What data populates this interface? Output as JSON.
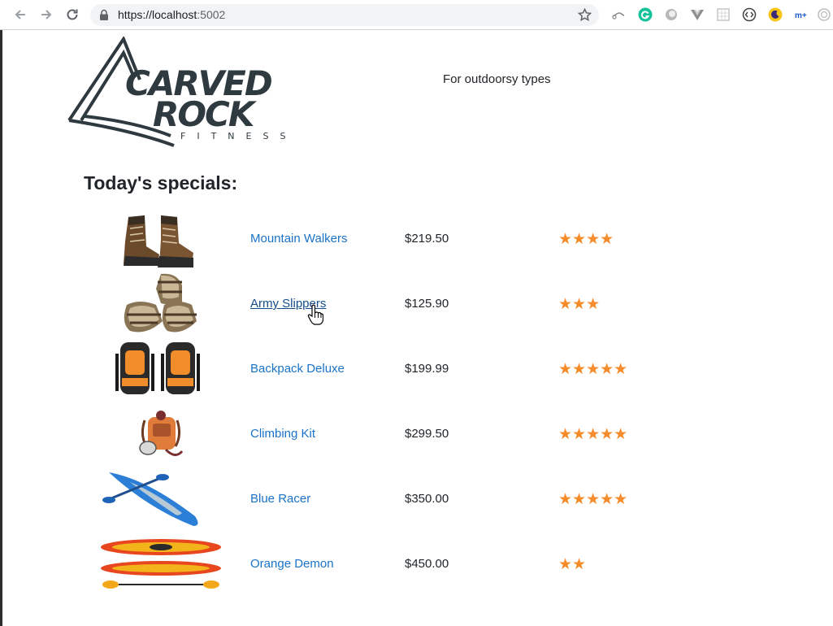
{
  "browser": {
    "url": "https://localhost:5002",
    "url_host": "https://localhost",
    "url_port": ":5002"
  },
  "header": {
    "logo_text": "CARVED ROCK FITNESS",
    "tagline": "For outdoorsy types"
  },
  "main": {
    "title": "Today's specials:",
    "products": [
      {
        "name": "Mountain Walkers",
        "price": "$219.50",
        "rating": 4,
        "stars": "★★★★"
      },
      {
        "name": "Army Slippers",
        "price": "$125.90",
        "rating": 3,
        "stars": "★★★"
      },
      {
        "name": "Backpack Deluxe",
        "price": "$199.99",
        "rating": 5,
        "stars": "★★★★★"
      },
      {
        "name": "Climbing Kit",
        "price": "$299.50",
        "rating": 5,
        "stars": "★★★★★"
      },
      {
        "name": "Blue Racer",
        "price": "$350.00",
        "rating": 5,
        "stars": "★★★★★"
      },
      {
        "name": "Orange Demon",
        "price": "$450.00",
        "rating": 2,
        "stars": "★★"
      }
    ]
  },
  "colors": {
    "link": "#1a73c8",
    "star": "#f68b2c",
    "logo": "#2f3a40"
  }
}
